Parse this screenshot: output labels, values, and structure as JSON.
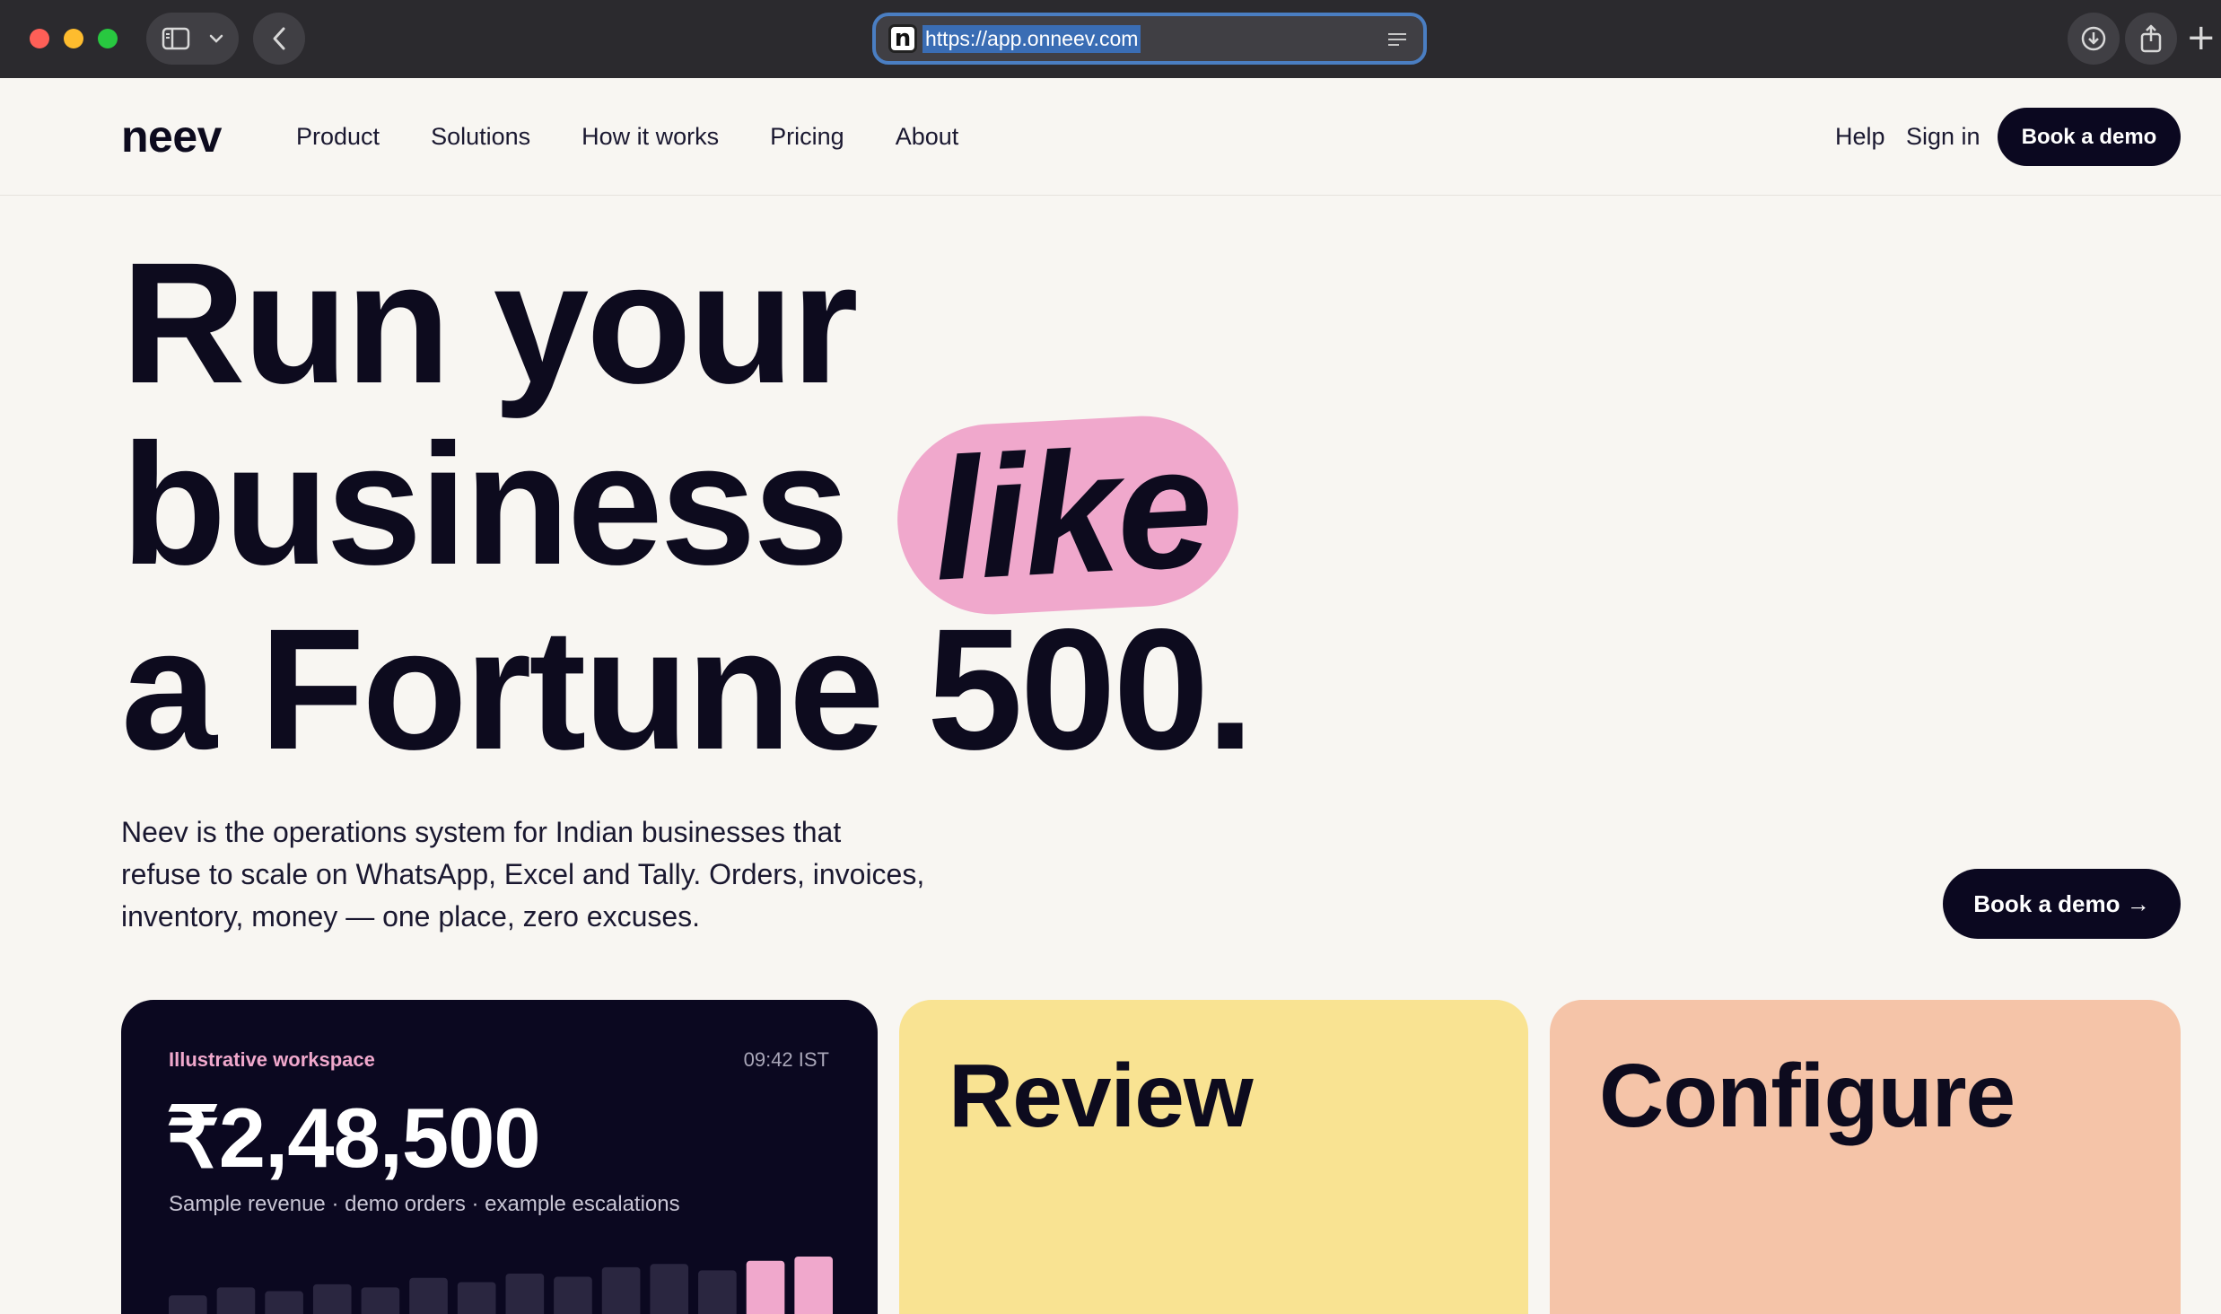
{
  "browser": {
    "url": "https://app.onneev.com",
    "site_icon_letter": "n",
    "new_tab_label": "+"
  },
  "header": {
    "logo": "neev",
    "nav": [
      {
        "label": "Product"
      },
      {
        "label": "Solutions"
      },
      {
        "label": "How it works"
      },
      {
        "label": "Pricing"
      },
      {
        "label": "About"
      }
    ],
    "help": "Help",
    "signin": "Sign in",
    "cta": "Book a demo"
  },
  "hero": {
    "line1": "Run your",
    "line2_pre": "business",
    "line2_highlight": "like",
    "line3": "a Fortune 500.",
    "lede": "Neev is the operations system for Indian businesses that refuse to scale on WhatsApp, Excel and Tally. Orders, invoices, inventory, money — one place, zero excuses.",
    "cta": "Book a demo →"
  },
  "cards": {
    "workspace": {
      "label": "Illustrative workspace",
      "time": "09:42 IST",
      "amount": "₹2,48,500",
      "subtitle": "Sample revenue · demo orders · example escalations"
    },
    "review": {
      "title": "Review"
    },
    "configure": {
      "title": "Configure"
    }
  },
  "chart_data": {
    "type": "bar",
    "values": [
      0.35,
      0.5,
      0.43,
      0.56,
      0.5,
      0.68,
      0.6,
      0.76,
      0.7,
      0.88,
      0.94,
      0.82,
      1.0,
      1.08
    ],
    "highlight_last": 2,
    "colors": {
      "base": "#2a2640",
      "highlight": "#f0a8cc"
    }
  },
  "colors": {
    "accent_pink": "#f0a8cc",
    "dark": "#0b0820",
    "card_yellow": "#f9e392",
    "card_peach": "#f5c4a8",
    "page_bg": "#f8f6f2"
  }
}
